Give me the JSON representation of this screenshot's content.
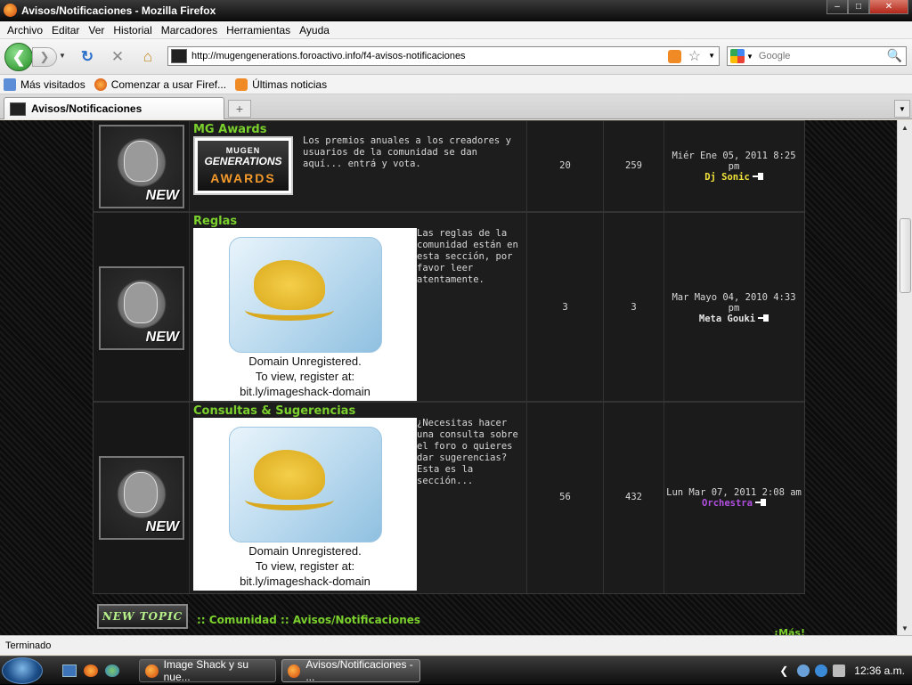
{
  "window": {
    "title": "Avisos/Notificaciones - Mozilla Firefox"
  },
  "menu": [
    "Archivo",
    "Editar",
    "Ver",
    "Historial",
    "Marcadores",
    "Herramientas",
    "Ayuda"
  ],
  "address": {
    "url": "http://mugengenerations.foroactivo.info/f4-avisos-notificaciones"
  },
  "search": {
    "placeholder": "Google"
  },
  "bookmarks": [
    "Más visitados",
    "Comenzar a usar Firef...",
    "Últimas noticias"
  ],
  "tab": {
    "title": "Avisos/Notificaciones",
    "new_tab": "+"
  },
  "forums": [
    {
      "title": "MG Awards",
      "image_lines": [
        "MUGEN",
        "GENERATIONS",
        "AWARDS"
      ],
      "description": "Los premios anuales a los creadores y usuarios de la comunidad se dan aquí... entrá y vota.",
      "topics": "20",
      "posts": "259",
      "last_date": "Miér Ene 05, 2011 8:25 pm",
      "last_author": "Dj Sonic",
      "author_color": "#f2e33a"
    },
    {
      "title": "Reglas",
      "image_text": [
        "Domain Unregistered.",
        "To view, register at:",
        "bit.ly/imageshack-domain"
      ],
      "description": "Las reglas de la comunidad están en esta sección, por favor leer atentamente.",
      "topics": "3",
      "posts": "3",
      "last_date": "Mar Mayo 04, 2010 4:33 pm",
      "last_author": "Meta Gouki",
      "author_color": "#e6e6e6"
    },
    {
      "title": "Consultas & Sugerencias",
      "image_text": [
        "Domain Unregistered.",
        "To view, register at:",
        "bit.ly/imageshack-domain"
      ],
      "description": "¿Necesitas hacer una consulta sobre el foro o quieres dar sugerencias? Esta es la sección...",
      "topics": "56",
      "posts": "432",
      "last_date": "Lun Mar 07, 2011 2:08 am",
      "last_author": "Orchestra",
      "author_color": "#b14fe0"
    }
  ],
  "new_badge": "NEW",
  "footer": {
    "new_topic": "NEW TOPIC",
    "crumb_sep": "::",
    "crumb_1": "Comunidad",
    "crumb_2": "Avisos/Notificaciones",
    "more": "¡Más!"
  },
  "status": {
    "text": "Terminado"
  },
  "taskbar": {
    "items": [
      "Image Shack y su nue...",
      "Avisos/Notificaciones - ..."
    ],
    "clock": "12:36 a.m."
  }
}
